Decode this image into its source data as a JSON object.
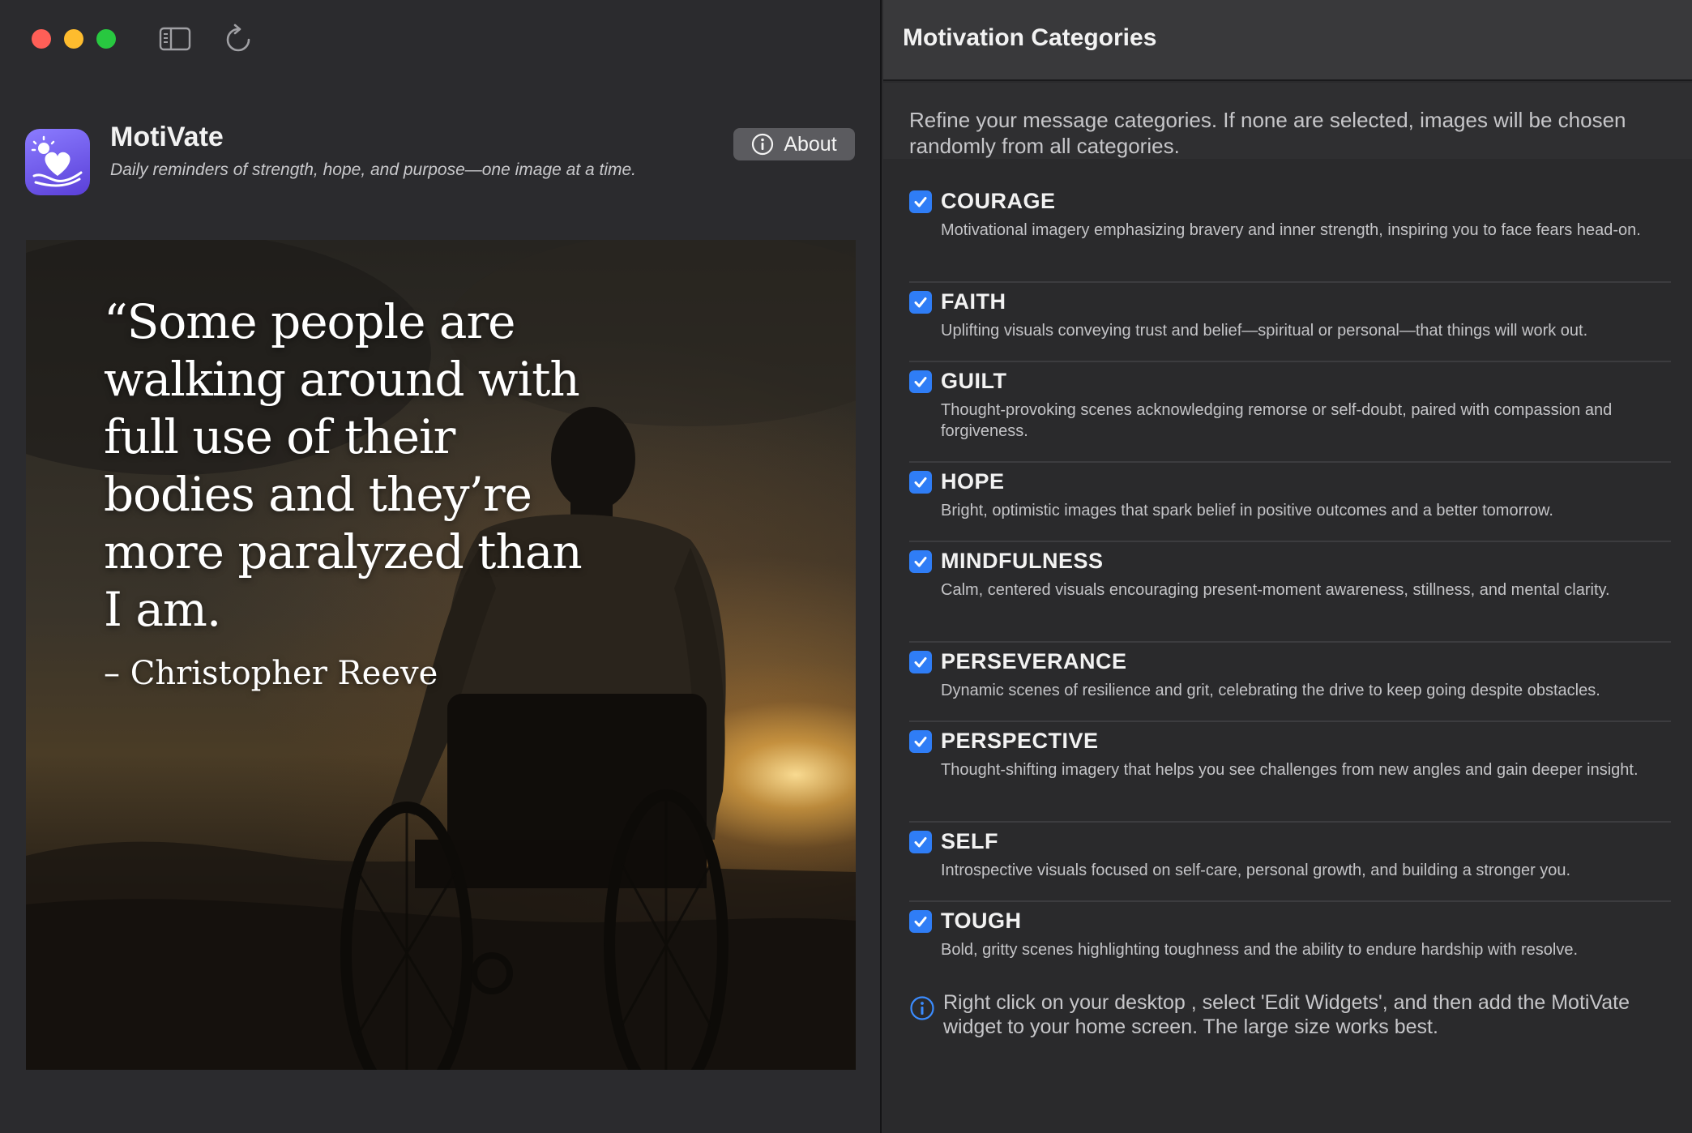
{
  "window": {
    "traffic_lights": [
      "close",
      "minimize",
      "zoom"
    ],
    "toolbar_icons": [
      "sidebar-toggle-icon",
      "reload-icon"
    ]
  },
  "app": {
    "name": "MotiVate",
    "tagline": "Daily reminders of strength, hope, and purpose—one image at a time.",
    "about_label": "About"
  },
  "quote": {
    "text": "“Some people are walking around with full use of their bodies and they’re more paralyzed than I am.",
    "author": "– Christopher Reeve"
  },
  "panel": {
    "title": "Motivation Categories",
    "intro": "Refine your message categories. If none are selected, images will be chosen randomly from all categories.",
    "categories": [
      {
        "name": "COURAGE",
        "checked": true,
        "desc": "Motivational imagery emphasizing bravery and inner strength, inspiring you to face fears head-on."
      },
      {
        "name": "FAITH",
        "checked": true,
        "desc": "Uplifting visuals conveying trust and belief—spiritual or personal—that things will work out."
      },
      {
        "name": "GUILT",
        "checked": true,
        "desc": "Thought-provoking scenes acknowledging remorse or self-doubt, paired with compassion and forgiveness."
      },
      {
        "name": "HOPE",
        "checked": true,
        "desc": "Bright, optimistic images that spark belief in positive outcomes and a better tomorrow."
      },
      {
        "name": "MINDFULNESS",
        "checked": true,
        "desc": "Calm, centered visuals encouraging present-moment awareness, stillness, and mental clarity."
      },
      {
        "name": "PERSEVERANCE",
        "checked": true,
        "desc": "Dynamic scenes of resilience and grit, celebrating the drive to keep going despite obstacles."
      },
      {
        "name": "PERSPECTIVE",
        "checked": true,
        "desc": "Thought-shifting imagery that helps you see challenges from new angles and gain deeper insight."
      },
      {
        "name": "SELF",
        "checked": true,
        "desc": "Introspective visuals focused on self-care, personal growth, and building a stronger you."
      },
      {
        "name": "TOUGH",
        "checked": true,
        "desc": "Bold, gritty scenes highlighting toughness and the ability to endure hardship with resolve."
      }
    ],
    "info": "Right click on your desktop , select 'Edit Widgets', and then add the MotiVate widget to your home screen. The large size works best."
  },
  "colors": {
    "accent": "#2f7df6",
    "close": "#ff5f57",
    "minimize": "#febc2e",
    "zoom": "#28c840"
  }
}
